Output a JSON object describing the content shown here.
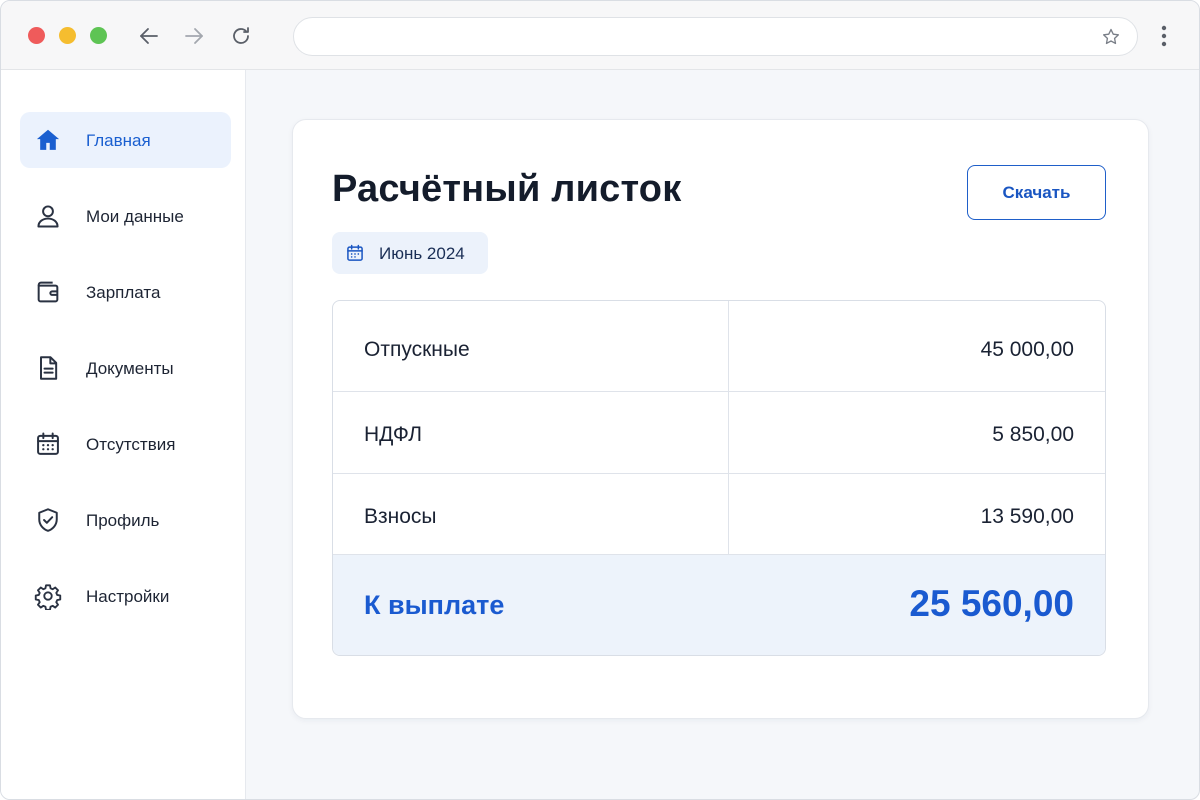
{
  "browser": {
    "url": "",
    "icons": [
      "arrow-left-icon",
      "arrow-right-icon",
      "reload-icon",
      "star-icon",
      "kebab-menu-icon"
    ]
  },
  "sidebar": {
    "items": [
      {
        "label": "Главная",
        "icon": "home-icon",
        "active": true
      },
      {
        "label": "Мои данные",
        "icon": "user-icon",
        "active": false
      },
      {
        "label": "Зарплата",
        "icon": "wallet-icon",
        "active": false
      },
      {
        "label": "Документы",
        "icon": "document-icon",
        "active": false
      },
      {
        "label": "Отсутствия",
        "icon": "calendar-icon",
        "active": false
      },
      {
        "label": "Профиль",
        "icon": "shield-check-icon",
        "active": false
      },
      {
        "label": "Настройки",
        "icon": "gear-icon",
        "active": false
      }
    ]
  },
  "main": {
    "title": "Расчётный листок",
    "download_label": "Скачать",
    "period": "Июнь 2024",
    "rows": [
      {
        "label": "Отпускные",
        "value": "45 000,00"
      },
      {
        "label": "НДФЛ",
        "value": "5 850,00"
      },
      {
        "label": "Взносы",
        "value": "13 590,00"
      }
    ],
    "total": {
      "label": "К выплате",
      "value": "25 560,00"
    }
  },
  "colors": {
    "accent": "#1a5ad0",
    "active_bg": "#ebf2fd",
    "total_bg": "#edf3fb"
  }
}
